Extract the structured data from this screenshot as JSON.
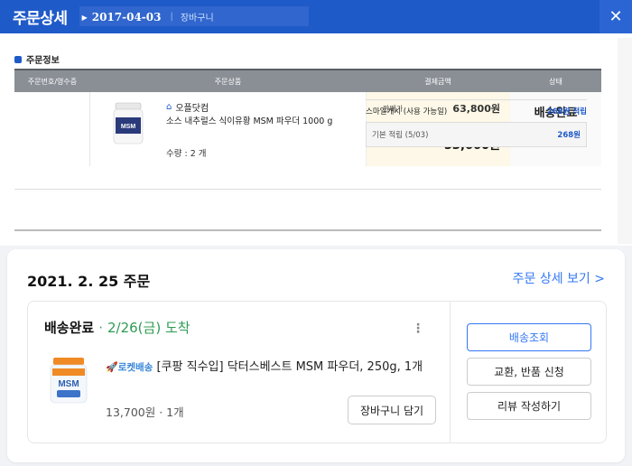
{
  "window": {
    "title": "주문상세",
    "date": "2017-04-03",
    "separator": "|",
    "subtitle": "장바구니",
    "close_icon": "close-icon"
  },
  "order_info": {
    "section_title": "주문정보",
    "columns": [
      "주문번호/영수증",
      "주문상품",
      "결제금액",
      "상태"
    ],
    "product": {
      "shop": "오플닷컴",
      "name": "소스 내추럴스 식이유황 MSM 파우더 1000 g",
      "qty": "수량 : 2 개"
    },
    "payment": {
      "sale_label": "판매가",
      "sale_value": "63,800원",
      "paid_label": "결제금액",
      "paid_value": "53,660원"
    },
    "status": "배송완료",
    "points": {
      "row1_label": "스마일캐시 (사용 가능일)",
      "row1_value": "268원 적립",
      "row2_label": "기본 적립 (5/03)",
      "row2_value": "268원"
    }
  },
  "card": {
    "order_date": "2021. 2. 25 주문",
    "detail_link": "주문 상세 보기 >",
    "delivery_status": "배송완료",
    "dot": "·",
    "arrival": "2/26(금) 도착",
    "kebab": "⋮",
    "rocket_label": "로켓배송",
    "item_title": "[쿠팡 직수입] 닥터스베스트 MSM 파우더, 250g, 1개",
    "item_price": "13,700원 · 1개",
    "cart_button": "장바구니 담기",
    "buttons": {
      "track": "배송조회",
      "exchange": "교환, 반품 신청",
      "review": "리뷰 작성하기"
    }
  },
  "colors": {
    "header_blue": "#1f5ac9",
    "link_blue": "#3478f6",
    "arrival_green": "#2e9b52"
  }
}
